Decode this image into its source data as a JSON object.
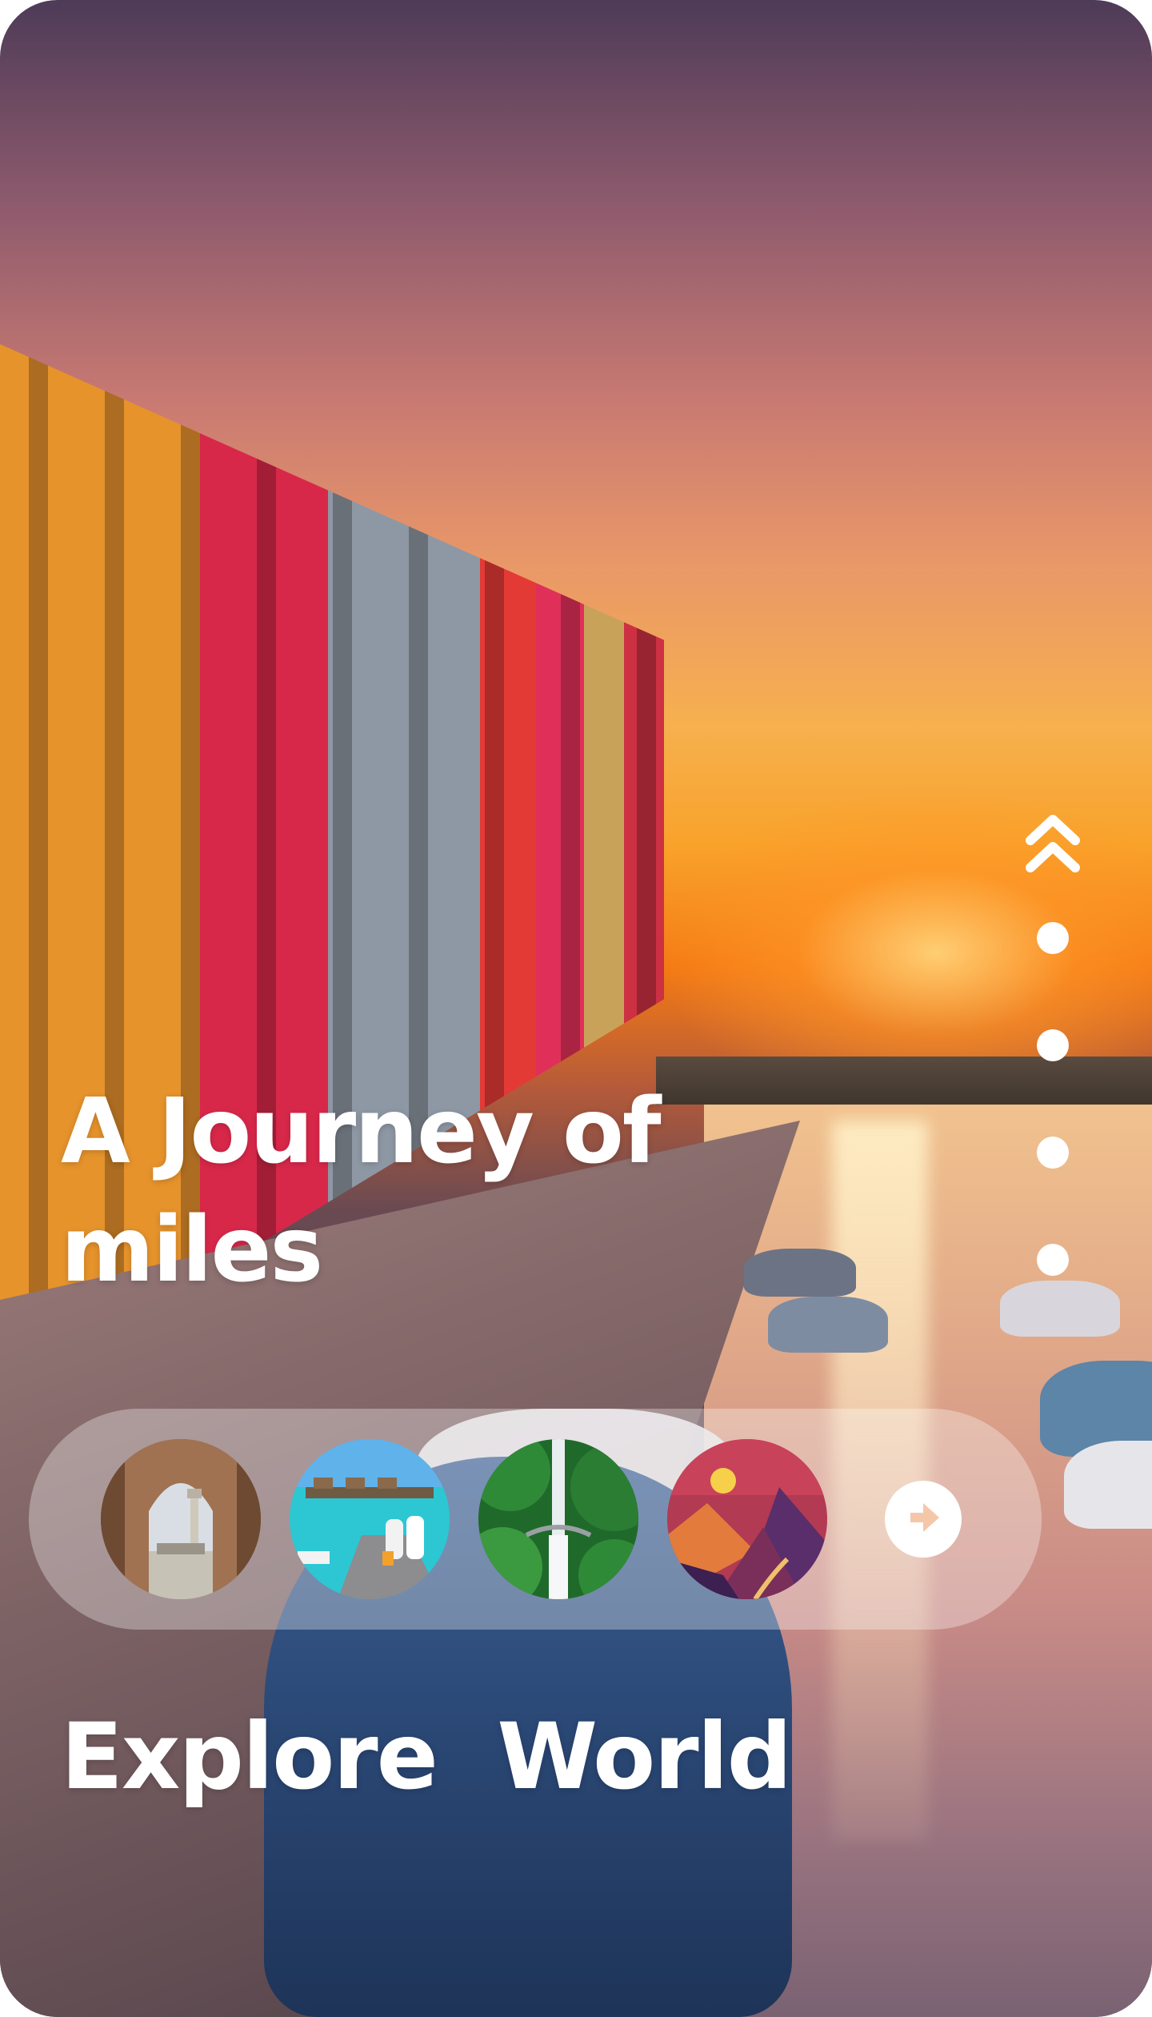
{
  "hero": {
    "title": "A Journey of miles",
    "image": "sunset-canal-colorful-houses-photo"
  },
  "pager": {
    "up_icon": "double-chevron-up-icon",
    "dot_count": 4
  },
  "destinations": {
    "items": [
      {
        "name": "arch-city-view-thumbnail"
      },
      {
        "name": "tropical-beach-couple-thumbnail"
      },
      {
        "name": "jungle-waterfall-thumbnail"
      },
      {
        "name": "sunset-mountains-illustration-thumbnail"
      }
    ],
    "next_icon": "arrow-right-circle-icon"
  },
  "footer": {
    "headline": "Explore  World"
  },
  "colors": {
    "text": "#ffffff",
    "pill_background": "rgba(255,255,255,0.32)",
    "accent_sunset": "#f7a02a"
  }
}
